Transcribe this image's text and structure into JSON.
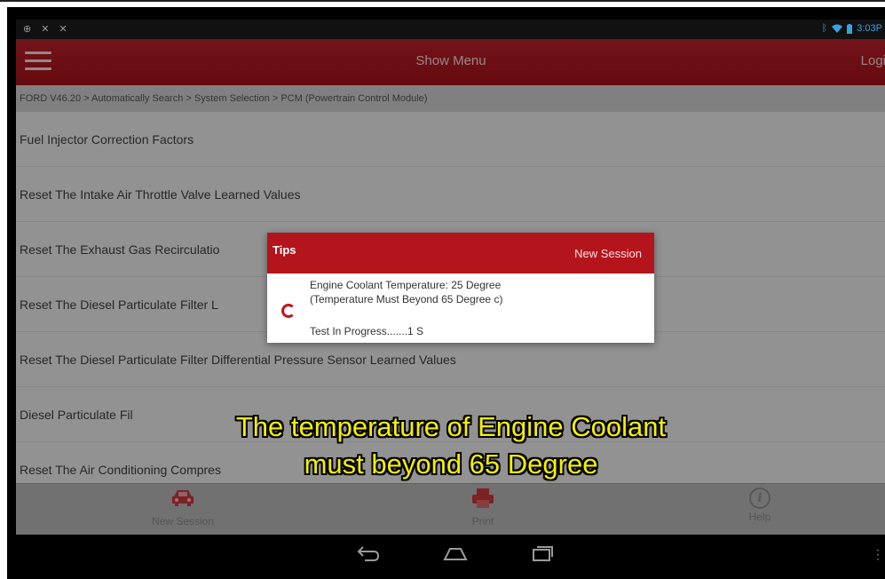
{
  "status_bar": {
    "left_icons": "⊕ ✕ ✕",
    "time": "3:03P"
  },
  "action_bar": {
    "title": "Show Menu",
    "login": "Logi"
  },
  "breadcrumb": "FORD V46.20 > Automatically Search > System Selection > PCM (Powertrain Control Module)",
  "list": [
    "Fuel Injector Correction Factors",
    "Reset The Intake Air Throttle Valve Learned Values",
    "Reset The Exhaust Gas Recirculatio",
    "Reset The Diesel Particulate Filter L",
    "Reset The Diesel Particulate Filter Differential Pressure Sensor Learned Values",
    "Diesel Particulate Fil",
    "Reset The Air Conditioning Compres"
  ],
  "dialog": {
    "title": "Tips",
    "new_session": "New Session",
    "line1": "Engine Coolant Temperature: 25 Degree",
    "line2": "(Temperature Must Beyond 65 Degree c)",
    "line3": "Test In Progress.......1 S"
  },
  "toolbar": {
    "new_session": "New Session",
    "print": "Print",
    "help": "Help"
  },
  "subtitle": {
    "line1": "The temperature of Engine Coolant",
    "line2": "must beyond 65 Degree"
  },
  "colors": {
    "accent": "#b4141c",
    "subtitle": "#f4f000"
  }
}
